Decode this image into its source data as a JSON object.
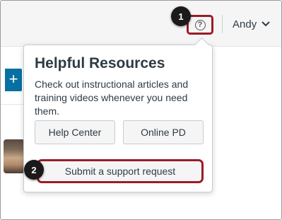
{
  "header": {
    "user_name": "Andy",
    "help_icon_glyph": "?"
  },
  "sidebar": {
    "add_glyph": "+"
  },
  "popover": {
    "title": "Helpful Resources",
    "description": "Check out instructional articles and training videos whenever you need them.",
    "buttons": {
      "help_center": "Help Center",
      "online_pd": "Online PD",
      "submit_support": "Submit a support request"
    }
  },
  "callouts": {
    "step1": "1",
    "step2": "2"
  },
  "colors": {
    "highlight": "#9b1c28",
    "accent": "#0770a3",
    "text": "#2d3b45"
  }
}
